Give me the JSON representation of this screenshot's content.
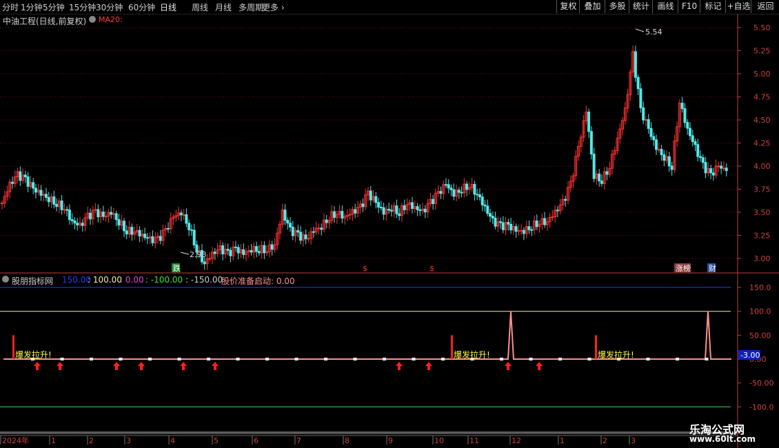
{
  "toolbar": {
    "periods": [
      "分时",
      "1分钟",
      "5分钟",
      "15分钟",
      "30分钟",
      "60分钟",
      "日线",
      "周线",
      "月线",
      "多周期",
      "更多"
    ],
    "active": "日线",
    "right": [
      "复权",
      "叠加",
      "多股",
      "统计",
      "画线",
      "F10",
      "标记",
      "+自选",
      "返回"
    ]
  },
  "main": {
    "title": "中油工程(日线,前复权)",
    "ma_label": "MA20:",
    "max_label": "5.54",
    "min_label": "2.93",
    "y_ticks": [
      "5.50",
      "5.25",
      "5.00",
      "4.75",
      "4.50",
      "4.25",
      "4.00",
      "3.75",
      "3.50",
      "3.25",
      "3.00"
    ],
    "markers": [
      {
        "text": "跌",
        "bg": "#1a8f2e"
      },
      {
        "text": "$",
        "bg": ""
      },
      {
        "text": "$",
        "bg": ""
      },
      {
        "text": "涨榜",
        "bg": "#8a3a3a"
      },
      {
        "text": "财",
        "bg": "#2a4ea0"
      }
    ]
  },
  "indicator": {
    "name": "股朋指标网",
    "legend": [
      {
        "text": "150.00",
        "color": "#2a3cff"
      },
      {
        "text": " : 100.00",
        "color": "#f0f0a0"
      },
      {
        "text": " : 0.00",
        "color": "#e040e0"
      },
      {
        "text": " : -100.00",
        "color": "#3fe03f"
      },
      {
        "text": " : -150.00",
        "color": "#cccccc"
      },
      {
        "text": "  股价准备启动: 0.00",
        "color": "#ff9090"
      }
    ],
    "y_ticks": [
      "150.0",
      "100.0",
      "50.00",
      "0.00",
      "-50.00",
      "-100.0"
    ],
    "current_value": "-3.00",
    "signal_text": "爆发拉升!"
  },
  "x_axis": {
    "labels": [
      "2024年",
      "1",
      "2",
      "3",
      "4",
      "5",
      "6",
      "7",
      "8",
      "9",
      "10",
      "11",
      "12",
      "1",
      "2",
      "3"
    ]
  },
  "watermark": {
    "line1": "乐淘公式网",
    "line2": "www.60lt.com"
  },
  "colors": {
    "up": "#ff3232",
    "down": "#54e8e8",
    "grid": "#7a1010",
    "axis": "#c04040"
  },
  "chart_data": {
    "type": "candlestick",
    "title": "中油工程(日线,前复权)",
    "ylim": [
      2.85,
      5.65
    ],
    "close_series_approx": [
      3.6,
      3.8,
      3.9,
      3.85,
      3.75,
      3.7,
      3.65,
      3.6,
      3.55,
      3.4,
      3.35,
      3.45,
      3.5,
      3.45,
      3.5,
      3.4,
      3.3,
      3.3,
      3.25,
      3.2,
      3.2,
      3.3,
      3.45,
      3.5,
      3.35,
      3.1,
      2.95,
      3.05,
      3.1,
      3.05,
      3.1,
      3.05,
      3.1,
      3.1,
      3.1,
      3.15,
      3.5,
      3.3,
      3.25,
      3.2,
      3.3,
      3.35,
      3.45,
      3.5,
      3.45,
      3.5,
      3.55,
      3.7,
      3.6,
      3.5,
      3.55,
      3.5,
      3.6,
      3.55,
      3.5,
      3.6,
      3.7,
      3.8,
      3.7,
      3.75,
      3.8,
      3.7,
      3.55,
      3.4,
      3.35,
      3.35,
      3.3,
      3.3,
      3.35,
      3.4,
      3.4,
      3.5,
      3.6,
      3.8,
      4.2,
      4.6,
      3.9,
      3.85,
      4.0,
      4.3,
      4.6,
      5.2,
      4.6,
      4.4,
      4.2,
      4.1,
      4.0,
      4.7,
      4.4,
      4.2,
      4.0,
      3.9,
      4.0,
      3.95
    ],
    "max": 5.54,
    "min": 2.93
  }
}
